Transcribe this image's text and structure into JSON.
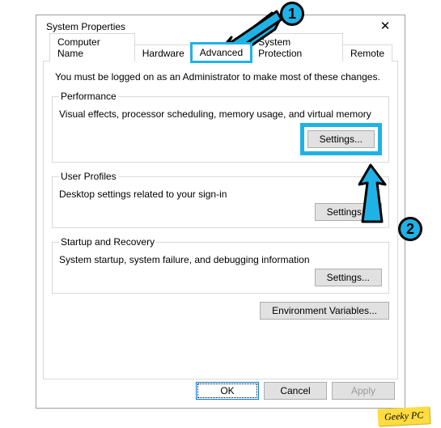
{
  "window": {
    "title": "System Properties"
  },
  "tabs": {
    "computer_name": "Computer Name",
    "hardware": "Hardware",
    "advanced": "Advanced",
    "system_protection": "System Protection",
    "remote": "Remote"
  },
  "panel": {
    "intro": "You must be logged on as an Administrator to make most of these changes.",
    "performance": {
      "legend": "Performance",
      "desc": "Visual effects, processor scheduling, memory usage, and virtual memory",
      "button": "Settings..."
    },
    "user_profiles": {
      "legend": "User Profiles",
      "desc": "Desktop settings related to your sign-in",
      "button": "Settings..."
    },
    "startup_recovery": {
      "legend": "Startup and Recovery",
      "desc": "System startup, system failure, and debugging information",
      "button": "Settings..."
    },
    "env_vars_button": "Environment Variables..."
  },
  "dialog_buttons": {
    "ok": "OK",
    "cancel": "Cancel",
    "apply": "Apply"
  },
  "annotation": {
    "step1": "1",
    "step2": "2"
  },
  "watermark": "Geeky PC"
}
